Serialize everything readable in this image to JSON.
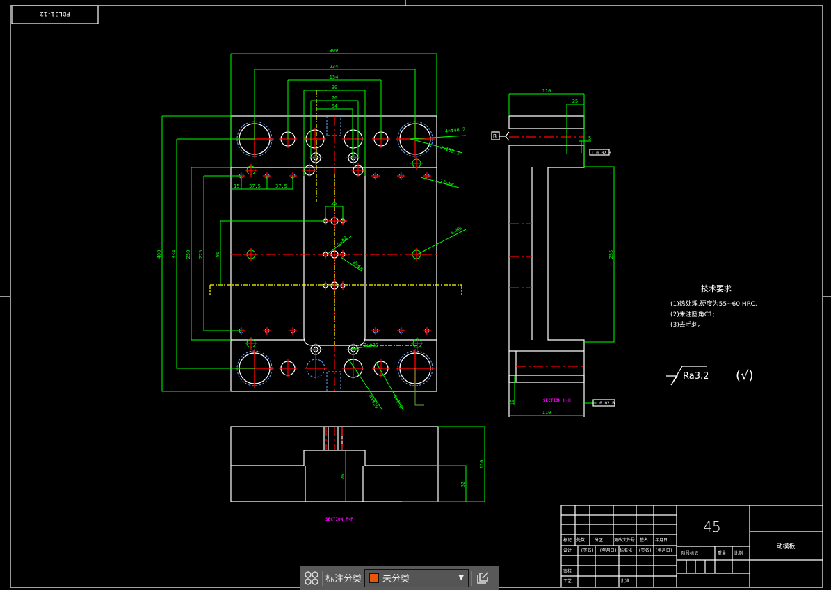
{
  "drawing": {
    "frame_label": "PDLJ1-12",
    "top_dims": [
      "309",
      "234",
      "134",
      "90",
      "70",
      "54"
    ],
    "left_dims": [
      "400",
      "334",
      "250",
      "225",
      "96"
    ],
    "pitch_dims": [
      "15",
      "37.5",
      "37.5"
    ],
    "center_dim": "25",
    "hole_callouts": [
      "4×Φ46.2",
      "4×Φ38.2",
      "12×M6",
      "6×M8",
      "2×Φ8",
      "8×Φ8",
      "2×Φ20",
      "4×Φ20",
      "4×Φ20"
    ],
    "side_dims": {
      "top_width": "110",
      "step": "25",
      "offset": "5",
      "height": "255",
      "bottom_width": "110",
      "left": "10"
    },
    "datum": "B",
    "tolerance_frames": [
      "⊥ 0.02 B",
      "⊥ 0.02 B"
    ],
    "section_dims": {
      "height": "110",
      "pocket_depth": "76",
      "lower": "52"
    },
    "section_hh": "SECTION H-H",
    "section_ff": "SECTION F-F"
  },
  "tech_requirements": {
    "title": "技术要求",
    "items": [
      "(1)热处理,硬度为55~60 HRC,",
      "(2)未注圆角C1;",
      "(3)去毛刺。"
    ]
  },
  "surface_finish": {
    "value": "Ra3.2",
    "other": "(√)"
  },
  "title_block": {
    "material": "45",
    "part_name": "动模板",
    "row1": [
      "标记",
      "处数",
      "分区",
      "更改文件号",
      "签名",
      "年月日"
    ],
    "row2": [
      "设计",
      "(签名)",
      "(年月日)",
      "标准化",
      "(签名)",
      "(年月日)"
    ],
    "row3": [
      "审核"
    ],
    "row4": [
      "工艺",
      "批准"
    ],
    "stage": [
      "阶段标记",
      "重量",
      "比例"
    ]
  },
  "toolbar": {
    "label": "标注分类",
    "selected": "未分类",
    "swatch_color": "#e8560a",
    "icons": [
      "grid-icon",
      "dropdown-arrow-icon",
      "edit-icon"
    ]
  },
  "colors": {
    "background": "#000000",
    "outline": "#ffffff",
    "dimension": "#00ff00",
    "centerline": "#ff0000",
    "section_label": "#ff00ff"
  }
}
